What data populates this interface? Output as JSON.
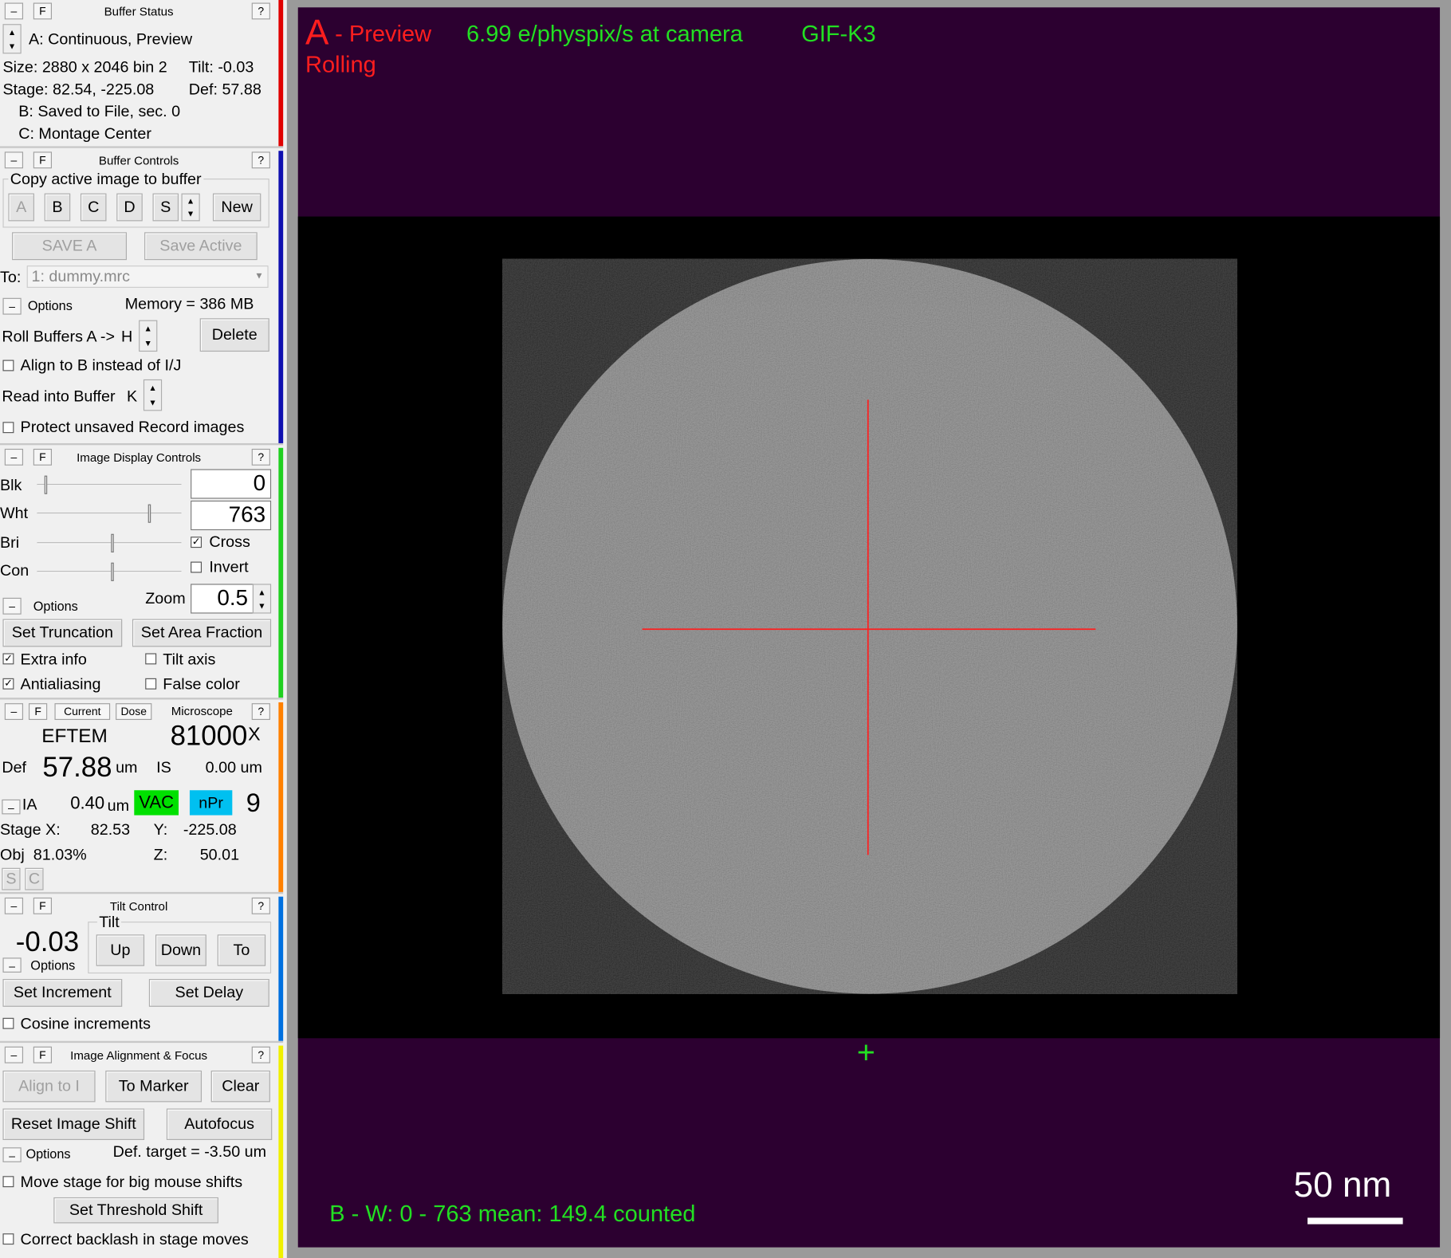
{
  "buffer_status": {
    "title": "Buffer Status",
    "line_a": "A: Continuous, Preview",
    "size": "Size: 2880 x 2046  bin 2",
    "tilt": "Tilt: -0.03",
    "stage": "Stage: 82.54, -225.08",
    "def": "Def: 57.88",
    "line_b": "B: Saved to File, sec. 0",
    "line_c": "C: Montage Center"
  },
  "buffer_controls": {
    "title": "Buffer Controls",
    "group": "Copy active image to buffer",
    "buffers": [
      "A",
      "B",
      "C",
      "D",
      "S"
    ],
    "new": "New",
    "save_a": "SAVE A",
    "save_active": "Save Active",
    "to_label": "To:",
    "to_file": "1: dummy.mrc",
    "options": "Options",
    "memory": "Memory = 386 MB",
    "roll": "Roll Buffers A ->",
    "roll_val": "H",
    "delete": "Delete",
    "align_b": "Align to B instead of I/J",
    "read_into": "Read into Buffer",
    "read_val": "K",
    "protect": "Protect unsaved Record images"
  },
  "display": {
    "title": "Image Display Controls",
    "blk": "Blk",
    "wht": "Wht",
    "bri": "Bri",
    "con": "Con",
    "blk_val": "0",
    "wht_val": "763",
    "cross": "Cross",
    "invert": "Invert",
    "options": "Options",
    "zoom_label": "Zoom",
    "zoom_val": "0.5",
    "set_trunc": "Set Truncation",
    "set_area": "Set Area Fraction",
    "extra": "Extra info",
    "tilt_axis": "Tilt axis",
    "antialias": "Antialiasing",
    "false_color": "False color",
    "cross_checked": true,
    "invert_checked": false,
    "extra_checked": true,
    "tilt_axis_checked": false,
    "antialias_checked": true,
    "false_color_checked": false
  },
  "microscope": {
    "title": "Microscope",
    "current": "Current",
    "dose": "Dose",
    "mode": "EFTEM",
    "mag": "81000",
    "x": "X",
    "def_label": "Def",
    "def_val": "57.88",
    "um": "um",
    "is_label": "IS",
    "is_val": "0.00 um",
    "ia": "IA",
    "ia_val": "0.40",
    "ia_unit": "um",
    "vac": "VAC",
    "npr": "nPr",
    "spot": "9",
    "stage_x_label": "Stage X:",
    "stage_x": "82.53",
    "y_label": "Y:",
    "y_val": "-225.08",
    "obj_label": "Obj",
    "obj_val": "81.03%",
    "z_label": "Z:",
    "z_val": "50.01",
    "s": "S",
    "c": "C",
    "vac_color": "#00e000",
    "npr_color": "#00c0f0"
  },
  "tilt": {
    "title": "Tilt Control",
    "value": "-0.03",
    "group": "Tilt",
    "up": "Up",
    "down": "Down",
    "to": "To",
    "options": "Options",
    "set_inc": "Set Increment",
    "set_delay": "Set Delay",
    "cosine": "Cosine increments"
  },
  "align": {
    "title": "Image Alignment & Focus",
    "align_to": "Align to I",
    "to_marker": "To Marker",
    "clear": "Clear",
    "reset": "Reset Image Shift",
    "autofocus": "Autofocus",
    "options": "Options",
    "def_target": "Def. target = -3.50 um",
    "move_stage": "Move stage for big mouse shifts",
    "threshold": "Set Threshold Shift",
    "backlash": "Correct backlash in stage moves"
  },
  "common": {
    "minus": "–",
    "f": "F",
    "q": "?"
  },
  "viewer": {
    "letter": "A",
    "mode": "- Preview",
    "rolling": "Rolling",
    "dose_rate": "6.99 e/physpix/s at camera",
    "camera": "GIF-K3",
    "bottom": "B - W: 0 - 763  mean: 149.4  counted",
    "scale": "50 nm",
    "red": "#ff1e1e",
    "green": "#22e022"
  },
  "panel_colors": [
    "#e00000",
    "#1010b0",
    "#20d020",
    "#ff8000",
    "#0070e0",
    "#f0f000"
  ]
}
